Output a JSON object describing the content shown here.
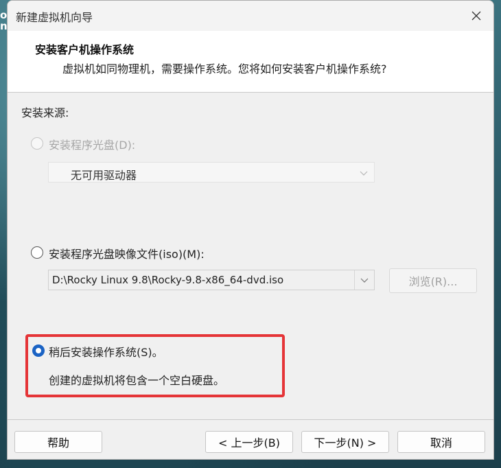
{
  "background": {
    "side_text": "oc\nn"
  },
  "window": {
    "title": "新建虚拟机向导",
    "close_icon": "close-icon"
  },
  "header": {
    "title": "安装客户机操作系统",
    "subtitle": "虚拟机如同物理机，需要操作系统。您将如何安装客户机操作系统?"
  },
  "content": {
    "source_label": "安装来源:",
    "options": [
      {
        "label": "安装程序光盘(D):",
        "selected": false,
        "enabled": false
      },
      {
        "label": "安装程序光盘映像文件(iso)(M):",
        "selected": false,
        "enabled": true
      },
      {
        "label": "稍后安装操作系统(S)。",
        "selected": true,
        "enabled": true
      }
    ],
    "disc_drive_value": "无可用驱动器",
    "iso_path_value": "D:\\Rocky Linux 9.8\\Rocky-9.8-x86_64-dvd.iso",
    "browse_label": "浏览(R)...",
    "later_description": "创建的虚拟机将包含一个空白硬盘。",
    "highlight_color": "#e53437",
    "accent_color": "#1b63c4"
  },
  "footer": {
    "help_label": "帮助",
    "back_label": "< 上一步(B)",
    "next_label": "下一步(N) >",
    "cancel_label": "取消"
  }
}
